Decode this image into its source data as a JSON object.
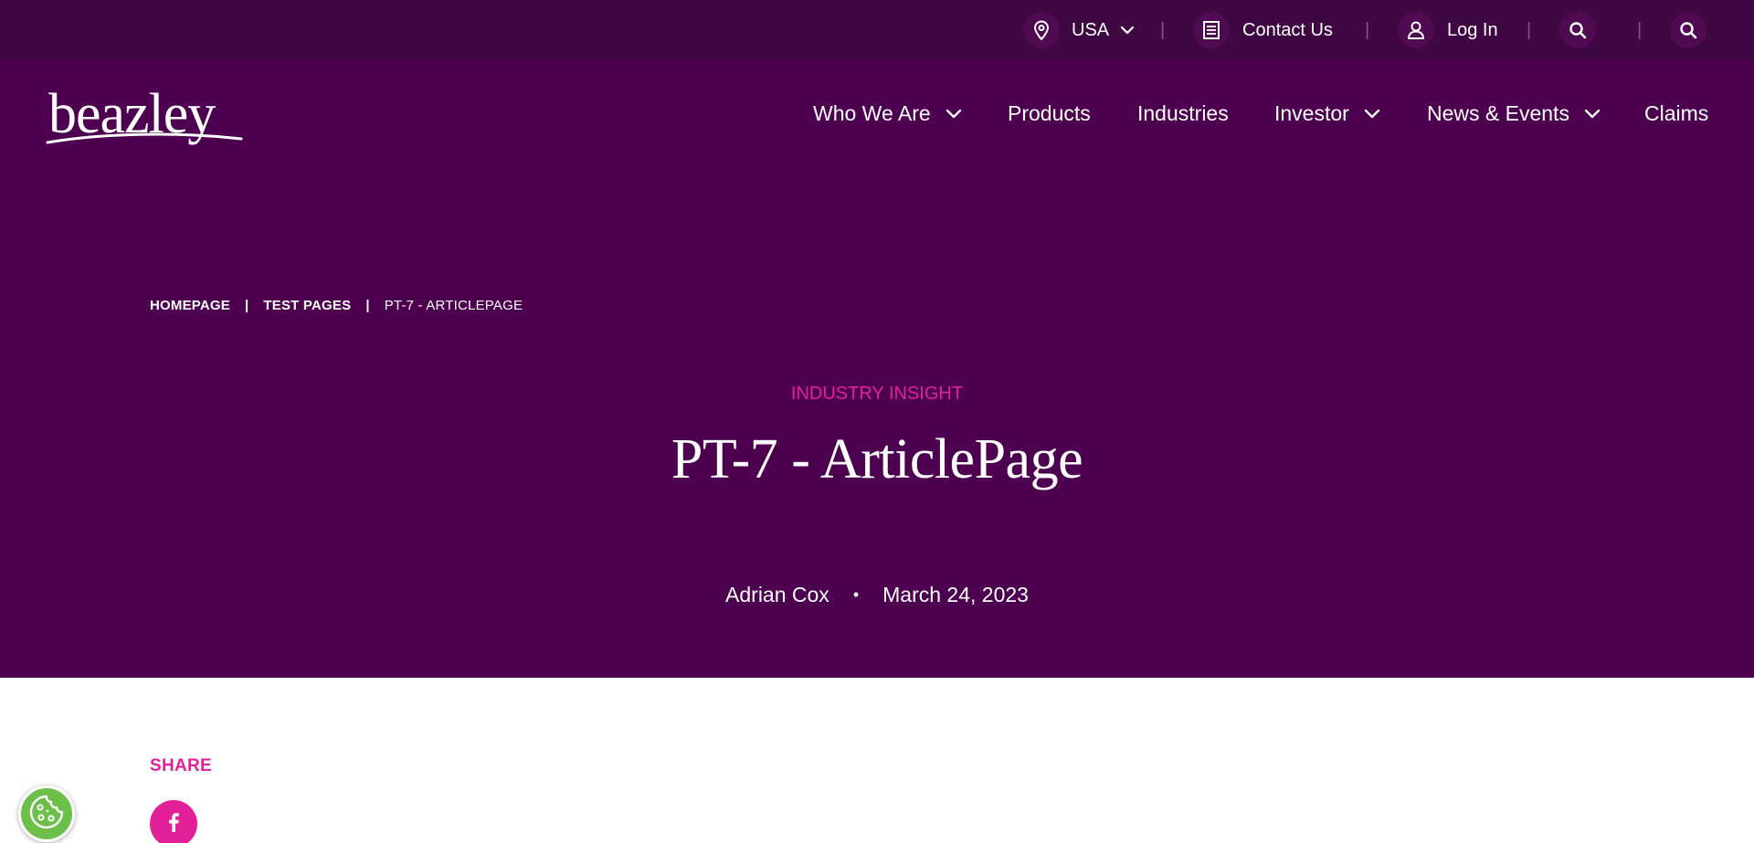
{
  "utility": {
    "region_label": "USA",
    "contact_label": "Contact Us",
    "login_label": "Log In",
    "separator": "|"
  },
  "logo": {
    "text": "beazley"
  },
  "nav": {
    "items": [
      {
        "label": "Who We Are",
        "has_dropdown": true
      },
      {
        "label": "Products",
        "has_dropdown": false
      },
      {
        "label": "Industries",
        "has_dropdown": false
      },
      {
        "label": "Investor",
        "has_dropdown": true
      },
      {
        "label": "News & Events",
        "has_dropdown": true
      },
      {
        "label": "Claims",
        "has_dropdown": false
      }
    ]
  },
  "breadcrumb": {
    "items": [
      "HOMEPAGE",
      "TEST PAGES",
      "PT-7 - ARTICLEPAGE"
    ],
    "separator": "|"
  },
  "article": {
    "category": "INDUSTRY INSIGHT",
    "title": "PT-7 - ArticlePage",
    "author": "Adrian Cox",
    "dot": "•",
    "date": "March 24, 2023"
  },
  "share": {
    "label": "SHARE"
  },
  "icons": {
    "location": "location-pin-icon",
    "chevron": "chevron-down-icon",
    "contact": "document-list-icon",
    "user": "user-icon",
    "search": "search-icon",
    "facebook": "facebook-icon",
    "cookie": "cookie-icon"
  },
  "colors": {
    "utility_bar": "#3f0842",
    "header": "#4d004f",
    "accent_pink": "#e2209a",
    "cookie_green": "#6cc04a",
    "text_white": "#ffffff"
  }
}
